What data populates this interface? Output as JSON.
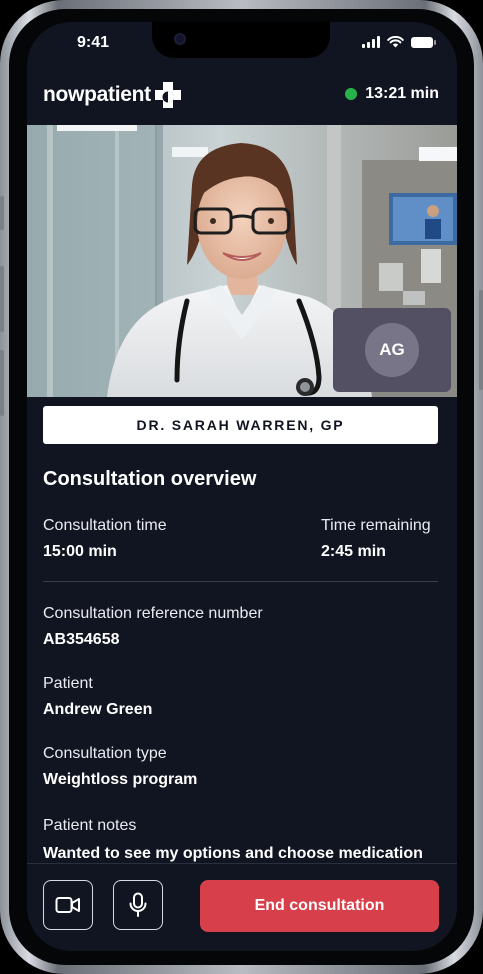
{
  "status_bar": {
    "time": "9:41"
  },
  "header": {
    "brand": "nowpatient",
    "timer": "13:21 min",
    "colors": {
      "live": "#28b34a"
    }
  },
  "video": {
    "doctor_name": "DR. SARAH WARREN, GP",
    "self_view_initials": "AG"
  },
  "overview": {
    "title": "Consultation overview",
    "consultation_time_label": "Consultation time",
    "consultation_time_value": "15:00 min",
    "time_remaining_label": "Time remaining",
    "time_remaining_value": "2:45 min",
    "reference_label": "Consultation reference number",
    "reference_value": "AB354658",
    "patient_label": "Patient",
    "patient_value": "Andrew Green",
    "type_label": "Consultation type",
    "type_value": "Weightloss program",
    "notes_label": "Patient notes",
    "notes_value": "Wanted to see my options and choose medication"
  },
  "actions": {
    "camera_icon": "video-camera-icon",
    "mic_icon": "microphone-icon",
    "end_label": "End consultation",
    "colors": {
      "end": "#d7404a"
    }
  }
}
